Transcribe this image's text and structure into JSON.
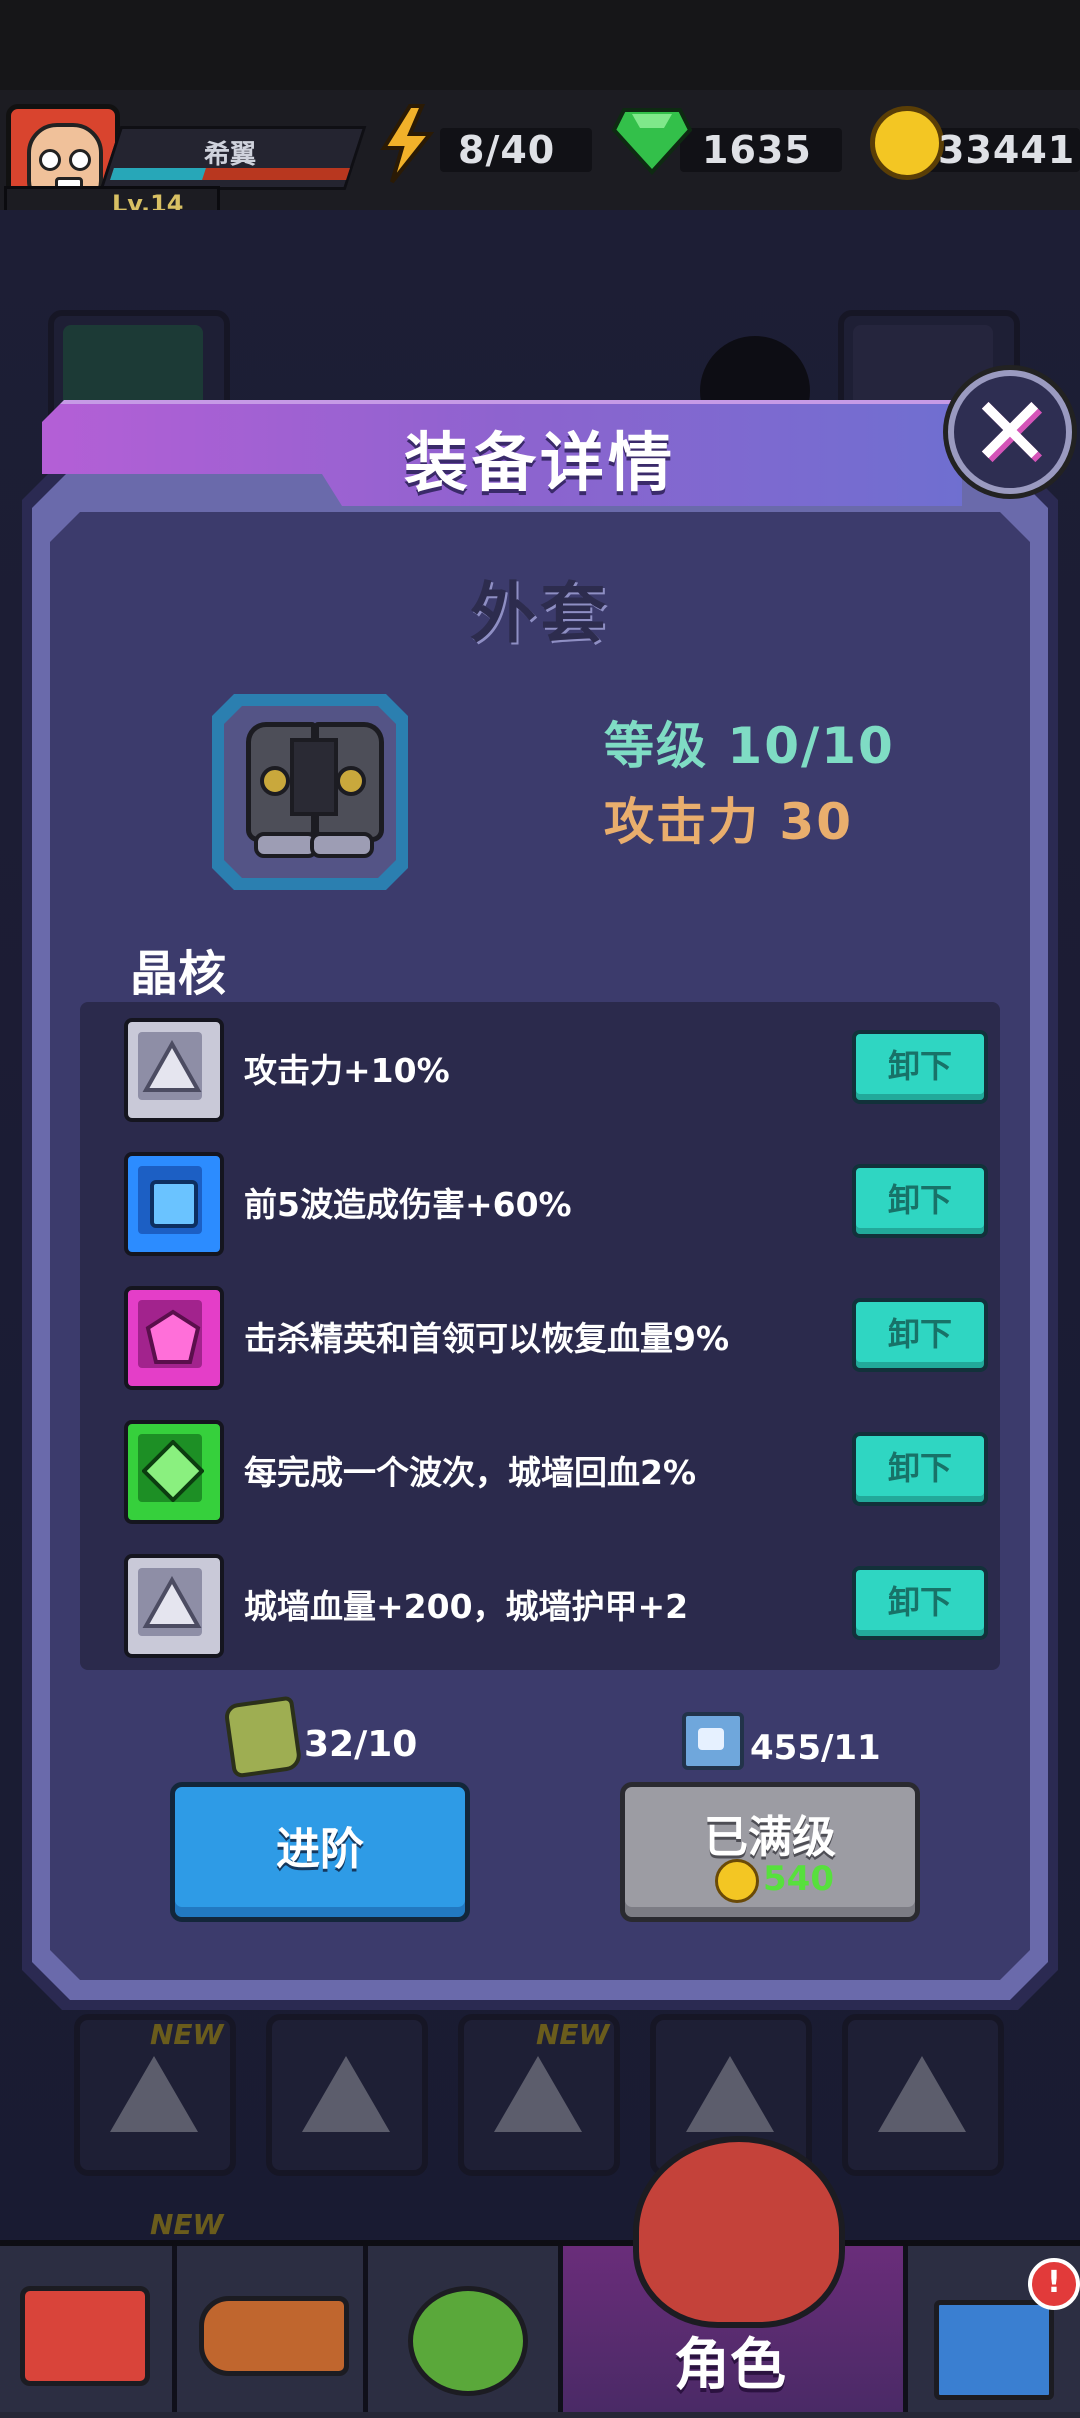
{
  "header": {
    "player_name": "希翼",
    "level": "Lv.14",
    "energy": "8/40",
    "gems": "1635",
    "coins": "33441"
  },
  "dialog": {
    "title": "装备详情",
    "close": "✕",
    "item_name": "外套",
    "level_label": "等级 10/10",
    "attack_label": "攻击力 30",
    "core_section_title": "晶核",
    "cores": [
      {
        "text": "攻击力+10%",
        "button": "卸下",
        "color": "#9fa0b8"
      },
      {
        "text": "前5波造成伤害+60%",
        "button": "卸下",
        "color": "#2c8cff"
      },
      {
        "text": "击杀精英和首领可以恢复血量9%",
        "button": "卸下",
        "color": "#e43ec8"
      },
      {
        "text": "每完成一个波次，城墙回血2%",
        "button": "卸下",
        "color": "#36d03c"
      },
      {
        "text": "城墙血量+200，城墙护甲+2",
        "button": "卸下",
        "color": "#9fa0b8"
      }
    ],
    "material_count": "32/10",
    "scroll_count": "455/11",
    "advance_button": "进阶",
    "max_button": "已满级",
    "max_price": "540"
  },
  "background": {
    "new_tag": "NEW"
  },
  "nav": {
    "active_label": "角色",
    "badge": "!"
  }
}
